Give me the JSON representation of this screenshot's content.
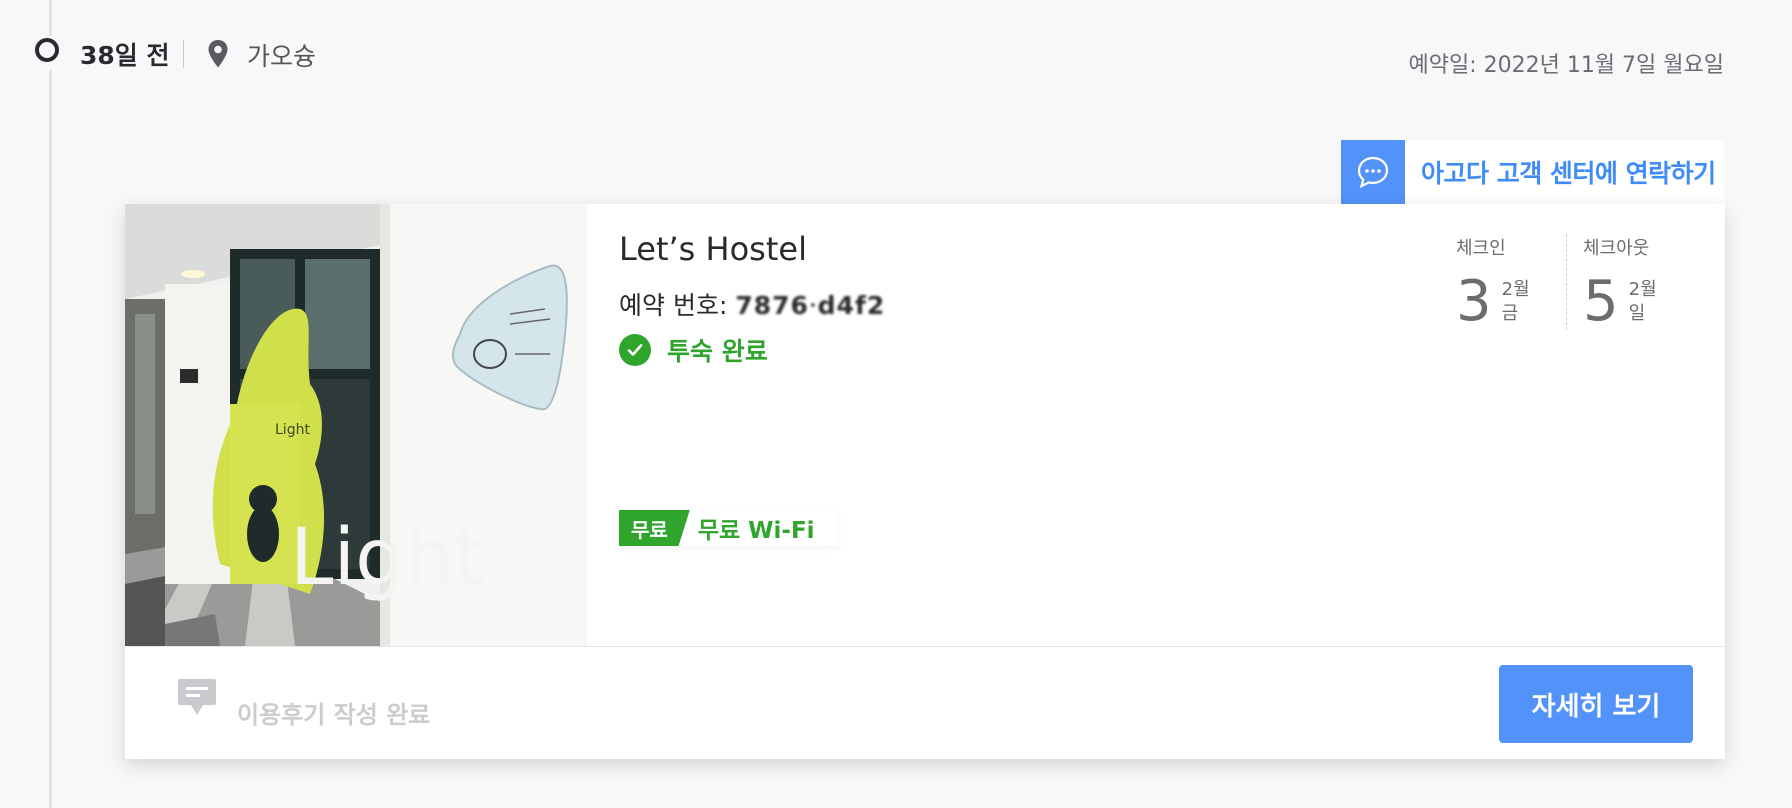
{
  "header": {
    "days_ago": "38일 전",
    "location": "가오슝",
    "booking_date": "예약일: 2022년 11월 7일 월요일"
  },
  "contact": {
    "label": "아고다 고객 센터에 연락하기"
  },
  "booking": {
    "hotel_name": "Let’s Hostel",
    "booking_no_label": "예약 번호: ",
    "booking_no_value": "7876ᐧd4f2",
    "status": "투숙 완료",
    "wifi_tag": "무료",
    "wifi_label": "무료 Wi-Fi",
    "photo_sign_text": "Light",
    "checkin": {
      "label": "체크인",
      "day": "3",
      "month": "2월",
      "weekday": "금"
    },
    "checkout": {
      "label": "체크아웃",
      "day": "5",
      "month": "2월",
      "weekday": "일"
    }
  },
  "footer": {
    "review_status": "이용후기 작성 완료",
    "details_button": "자세히 보기"
  },
  "colors": {
    "accent_blue": "#5392f9",
    "success_green": "#2fa52e"
  },
  "icons": [
    "pin-icon",
    "chat-bubble-icon",
    "check-circle-icon",
    "review-icon"
  ]
}
